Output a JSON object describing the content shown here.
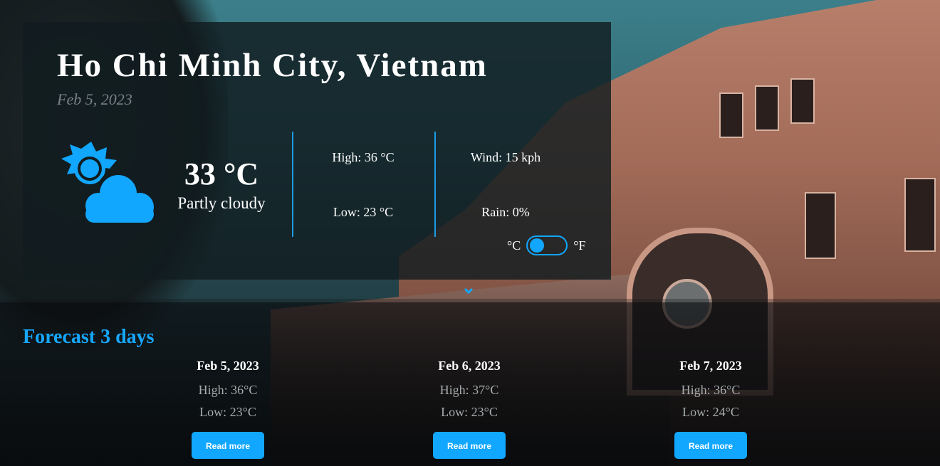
{
  "location": {
    "city": "Ho Chi Minh City, Vietnam",
    "date": "Feb 5, 2023"
  },
  "current": {
    "icon": "partly-cloudy-icon",
    "temperature": "33 °C",
    "condition": "Partly cloudy",
    "high": "High: 36 °C",
    "low": "Low: 23 °C",
    "wind": "Wind: 15 kph",
    "rain": "Rain: 0%"
  },
  "units": {
    "celsius": "°C",
    "fahrenheit": "°F",
    "selected": "°C"
  },
  "forecast": {
    "title": "Forecast 3 days",
    "days": [
      {
        "date": "Feb 5, 2023",
        "high": "High: 36°C",
        "low": "Low: 23°C",
        "button": "Read more"
      },
      {
        "date": "Feb 6, 2023",
        "high": "High: 37°C",
        "low": "Low: 23°C",
        "button": "Read more"
      },
      {
        "date": "Feb 7, 2023",
        "high": "High: 36°C",
        "low": "Low: 24°C",
        "button": "Read more"
      }
    ]
  },
  "colors": {
    "accent": "#12a7ff",
    "card": "#111c20",
    "muted": "#a7acad"
  }
}
